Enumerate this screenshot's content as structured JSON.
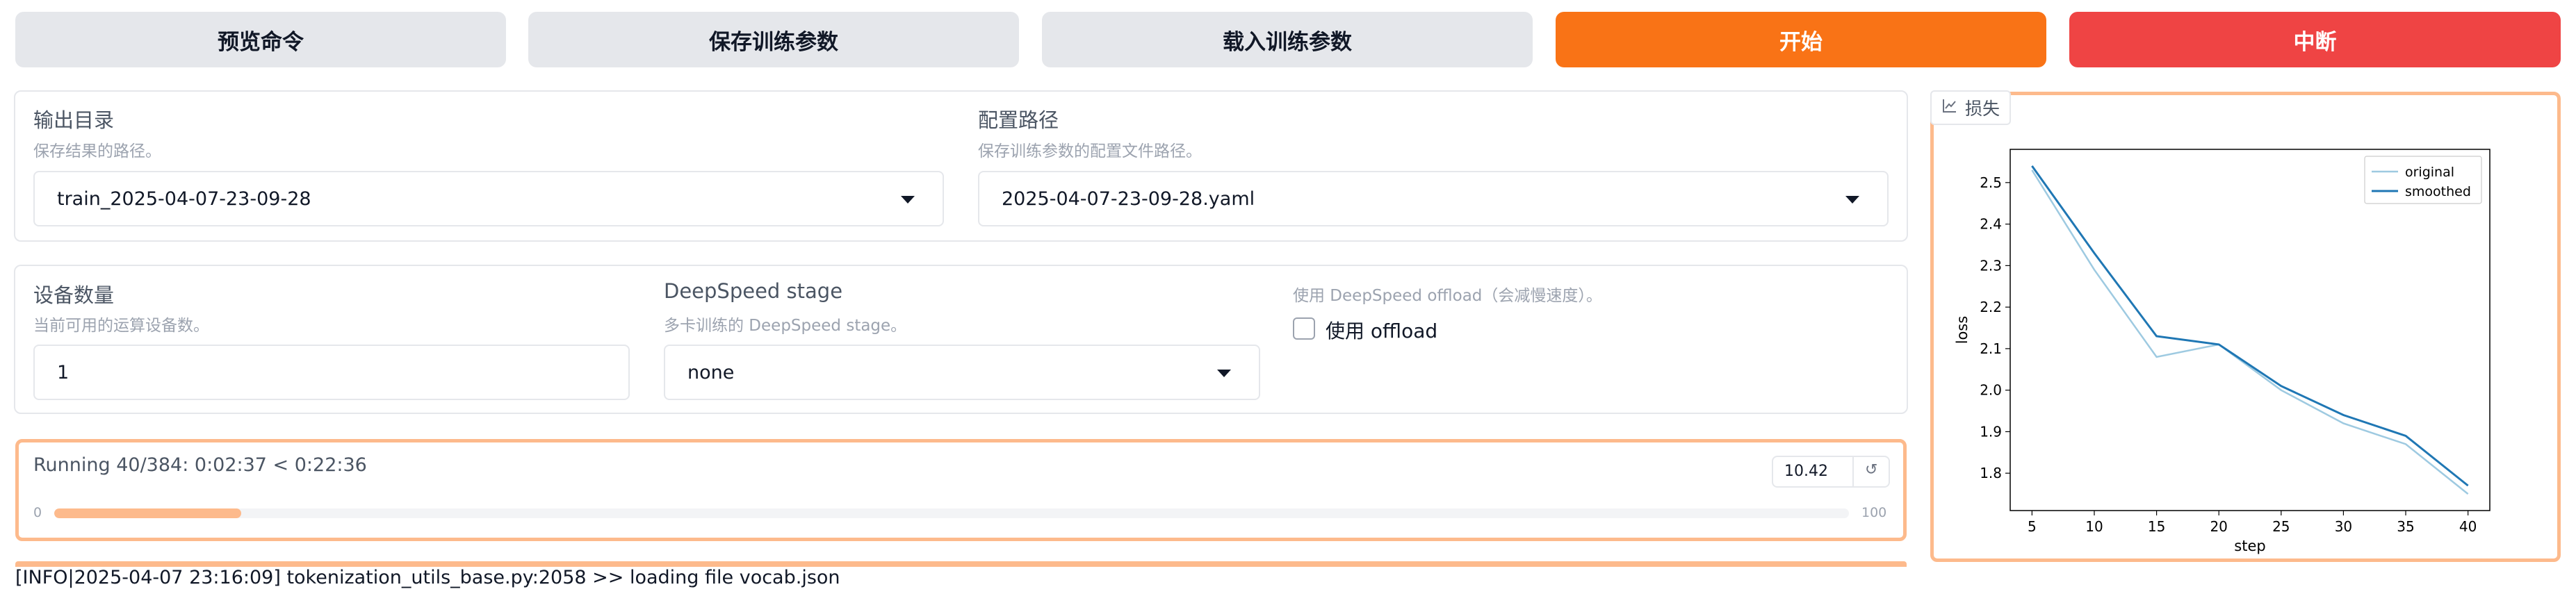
{
  "toolbar": {
    "preview_label": "预览命令",
    "save_label": "保存训练参数",
    "load_label": "载入训练参数",
    "start_label": "开始",
    "abort_label": "中断"
  },
  "output_dir": {
    "label": "输出目录",
    "info": "保存结果的路径。",
    "value": "train_2025-04-07-23-09-28"
  },
  "config_path": {
    "label": "配置路径",
    "info": "保存训练参数的配置文件路径。",
    "value": "2025-04-07-23-09-28.yaml"
  },
  "device_count": {
    "label": "设备数量",
    "info": "当前可用的运算设备数。",
    "value": "1"
  },
  "ds_stage": {
    "label": "DeepSpeed stage",
    "info": "多卡训练的 DeepSpeed stage。",
    "value": "none"
  },
  "ds_offload": {
    "info": "使用 DeepSpeed offload（会减慢速度）。",
    "label": "使用 offload",
    "checked": false
  },
  "progress": {
    "text": "Running 40/384: 0:02:37 < 0:22:36",
    "fraction": 0.104,
    "min_label": "0",
    "max_label": "100",
    "number_value": "10.42"
  },
  "log": {
    "line": "[INFO|2025-04-07 23:16:09] tokenization_utils_base.py:2058 >> loading file vocab.json"
  },
  "loss_tab": {
    "label": "损失",
    "icon": "line-chart-icon"
  },
  "colors": {
    "original": "#9ecae1",
    "smoothed": "#1f77b4",
    "accent": "#f97316",
    "danger": "#ef4444"
  },
  "chart_data": {
    "type": "line",
    "title": "",
    "xlabel": "step",
    "ylabel": "loss",
    "xlim": [
      3.25,
      41.75
    ],
    "ylim": [
      1.71,
      2.58
    ],
    "xticks": [
      5,
      10,
      15,
      20,
      25,
      30,
      35,
      40
    ],
    "yticks": [
      1.8,
      1.9,
      2.0,
      2.1,
      2.2,
      2.3,
      2.4,
      2.5
    ],
    "legend_position": "top-right",
    "grid": false,
    "series": [
      {
        "name": "original",
        "x": [
          5,
          10,
          15,
          20,
          25,
          30,
          35,
          40
        ],
        "y": [
          2.53,
          2.29,
          2.08,
          2.11,
          2.0,
          1.92,
          1.87,
          1.75
        ]
      },
      {
        "name": "smoothed",
        "x": [
          5,
          10,
          15,
          20,
          25,
          30,
          35,
          40
        ],
        "y": [
          2.54,
          2.33,
          2.13,
          2.11,
          2.01,
          1.94,
          1.89,
          1.77
        ]
      }
    ]
  }
}
